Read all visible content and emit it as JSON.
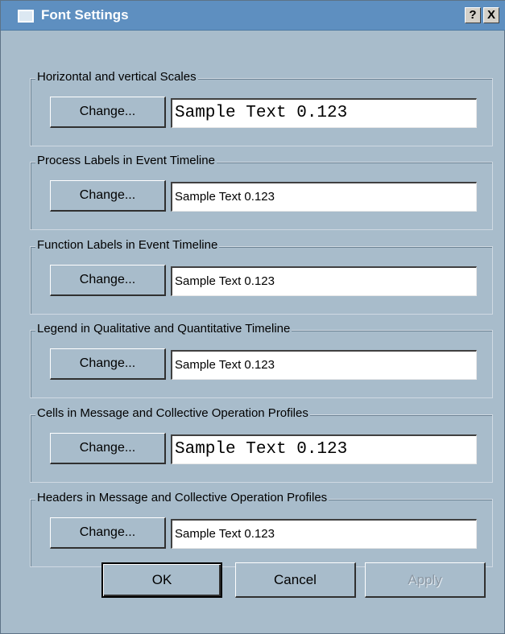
{
  "window": {
    "title": "Font Settings",
    "help_label": "?",
    "close_label": "X"
  },
  "groups": [
    {
      "label": "Horizontal and vertical Scales",
      "button": "Change...",
      "sample": "Sample Text 0.123",
      "font": "mono"
    },
    {
      "label": "Process Labels in Event Timeline",
      "button": "Change...",
      "sample": "Sample Text 0.123",
      "font": "sans"
    },
    {
      "label": "Function Labels in Event Timeline",
      "button": "Change...",
      "sample": "Sample Text 0.123",
      "font": "sans"
    },
    {
      "label": "Legend in Qualitative and Quantitative Timeline",
      "button": "Change...",
      "sample": "Sample Text 0.123",
      "font": "sans"
    },
    {
      "label": "Cells in Message and Collective Operation Profiles",
      "button": "Change...",
      "sample": "Sample Text 0.123",
      "font": "mono"
    },
    {
      "label": "Headers in Message and Collective Operation Profiles",
      "button": "Change...",
      "sample": "Sample Text 0.123",
      "font": "sans"
    }
  ],
  "buttons": {
    "ok": "OK",
    "cancel": "Cancel",
    "apply": "Apply"
  }
}
